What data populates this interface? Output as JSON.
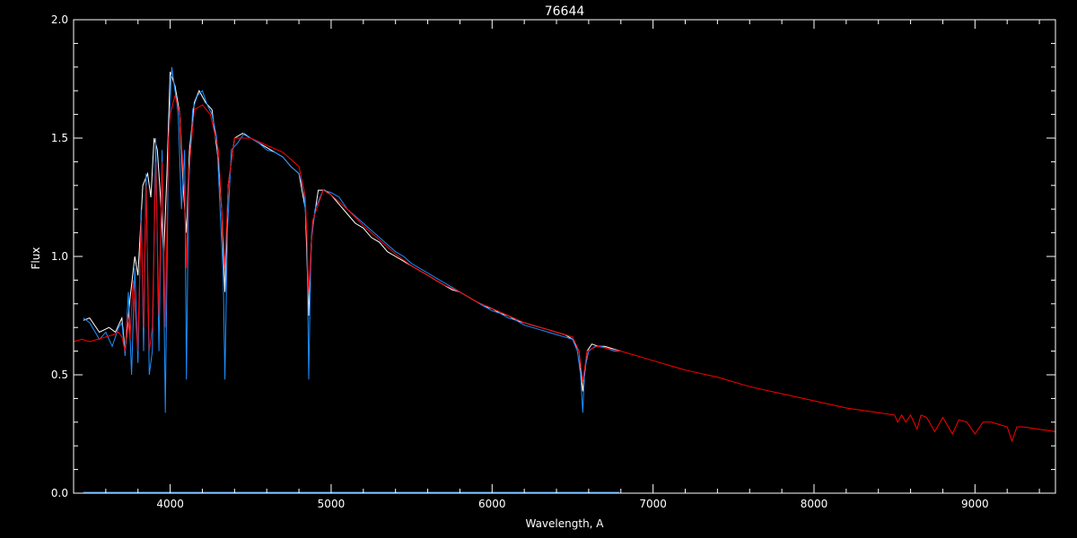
{
  "chart_data": {
    "type": "line",
    "title": "76644",
    "xlabel": "Wavelength, A",
    "ylabel": "Flux",
    "xlim": [
      3400,
      9500
    ],
    "ylim": [
      0.0,
      2.0
    ],
    "xticks": [
      4000,
      5000,
      6000,
      7000,
      8000,
      9000
    ],
    "xtick_labels": [
      "4000",
      "5000",
      "6000",
      "7000",
      "8000",
      "9000"
    ],
    "yticks": [
      0.0,
      0.5,
      1.0,
      1.5,
      2.0
    ],
    "ytick_labels": [
      "0.0",
      "0.5",
      "1.0",
      "1.5",
      "2.0"
    ],
    "grid": false,
    "background": "#000000",
    "axis_color": "#ffffff",
    "series": [
      {
        "color": "#ffffff",
        "x": [
          3460,
          3500,
          3560,
          3620,
          3660,
          3700,
          3720,
          3750,
          3780,
          3800,
          3830,
          3860,
          3880,
          3900,
          3920,
          3940,
          3960,
          3980,
          4000,
          4030,
          4060,
          4080,
          4101,
          4120,
          4150,
          4180,
          4220,
          4260,
          4300,
          4320,
          4340,
          4360,
          4400,
          4450,
          4500,
          4550,
          4600,
          4650,
          4700,
          4750,
          4800,
          4840,
          4861,
          4880,
          4920,
          4960,
          5000,
          5050,
          5100,
          5150,
          5200,
          5250,
          5300,
          5350,
          5400,
          5450,
          5500,
          5550,
          5600,
          5650,
          5700,
          5750,
          5800,
          5850,
          5900,
          5950,
          6000,
          6050,
          6100,
          6150,
          6200,
          6250,
          6300,
          6350,
          6400,
          6450,
          6500,
          6540,
          6563,
          6590,
          6620,
          6660,
          6700,
          6750,
          6800
        ],
        "y": [
          0.73,
          0.74,
          0.68,
          0.7,
          0.68,
          0.74,
          0.6,
          0.82,
          1.0,
          0.92,
          1.3,
          1.35,
          1.25,
          1.5,
          1.45,
          1.25,
          1.0,
          1.35,
          1.78,
          1.72,
          1.6,
          1.3,
          1.1,
          1.45,
          1.65,
          1.7,
          1.65,
          1.62,
          1.4,
          1.2,
          0.85,
          1.3,
          1.5,
          1.52,
          1.5,
          1.48,
          1.46,
          1.44,
          1.42,
          1.38,
          1.35,
          1.2,
          0.75,
          1.1,
          1.28,
          1.28,
          1.26,
          1.22,
          1.18,
          1.14,
          1.12,
          1.08,
          1.06,
          1.02,
          1.0,
          0.98,
          0.96,
          0.94,
          0.92,
          0.9,
          0.88,
          0.86,
          0.85,
          0.83,
          0.81,
          0.79,
          0.78,
          0.76,
          0.75,
          0.73,
          0.72,
          0.71,
          0.7,
          0.69,
          0.68,
          0.67,
          0.65,
          0.6,
          0.43,
          0.6,
          0.63,
          0.62,
          0.62,
          0.61,
          0.6
        ]
      },
      {
        "color": "#1e8fff",
        "x": [
          3460,
          3500,
          3560,
          3600,
          3640,
          3680,
          3700,
          3720,
          3740,
          3760,
          3780,
          3800,
          3820,
          3835,
          3850,
          3870,
          3889,
          3910,
          3930,
          3950,
          3970,
          3990,
          4010,
          4030,
          4050,
          4070,
          4090,
          4101,
          4115,
          4140,
          4170,
          4200,
          4230,
          4260,
          4290,
          4310,
          4330,
          4340,
          4355,
          4380,
          4420,
          4460,
          4500,
          4550,
          4600,
          4650,
          4700,
          4750,
          4800,
          4830,
          4850,
          4861,
          4875,
          4900,
          4950,
          5000,
          5050,
          5100,
          5150,
          5200,
          5250,
          5300,
          5350,
          5400,
          5450,
          5500,
          5550,
          5600,
          5650,
          5700,
          5750,
          5800,
          5850,
          5900,
          5950,
          6000,
          6050,
          6100,
          6150,
          6200,
          6250,
          6300,
          6350,
          6400,
          6450,
          6500,
          6530,
          6550,
          6563,
          6575,
          6600,
          6640,
          6680,
          6720,
          6760,
          6790
        ],
        "y": [
          0.74,
          0.72,
          0.65,
          0.68,
          0.62,
          0.7,
          0.72,
          0.58,
          0.85,
          0.5,
          0.95,
          0.55,
          1.2,
          0.6,
          1.35,
          0.5,
          0.6,
          1.5,
          0.6,
          1.45,
          0.34,
          1.5,
          1.8,
          1.7,
          1.6,
          1.2,
          1.45,
          0.48,
          1.3,
          1.62,
          1.68,
          1.7,
          1.64,
          1.6,
          1.5,
          1.2,
          0.9,
          0.48,
          1.1,
          1.45,
          1.48,
          1.52,
          1.5,
          1.48,
          1.45,
          1.44,
          1.42,
          1.38,
          1.35,
          1.28,
          1.1,
          0.48,
          1.05,
          1.2,
          1.28,
          1.27,
          1.25,
          1.2,
          1.17,
          1.14,
          1.11,
          1.08,
          1.05,
          1.02,
          1.0,
          0.97,
          0.95,
          0.93,
          0.91,
          0.89,
          0.87,
          0.85,
          0.83,
          0.81,
          0.79,
          0.77,
          0.76,
          0.74,
          0.73,
          0.71,
          0.7,
          0.69,
          0.68,
          0.67,
          0.66,
          0.65,
          0.6,
          0.5,
          0.34,
          0.52,
          0.6,
          0.62,
          0.62,
          0.61,
          0.6,
          0.6
        ]
      },
      {
        "color": "#ff0000",
        "x": [
          3400,
          3450,
          3500,
          3550,
          3600,
          3650,
          3680,
          3700,
          3720,
          3735,
          3750,
          3770,
          3798,
          3820,
          3835,
          3850,
          3870,
          3889,
          3910,
          3930,
          3950,
          3970,
          3990,
          4000,
          4030,
          4060,
          4090,
          4101,
          4115,
          4150,
          4200,
          4250,
          4300,
          4320,
          4340,
          4360,
          4400,
          4500,
          4600,
          4700,
          4800,
          4840,
          4861,
          4885,
          4950,
          5000,
          5100,
          5200,
          5300,
          5400,
          5500,
          5600,
          5700,
          5800,
          5900,
          6000,
          6100,
          6200,
          6300,
          6400,
          6500,
          6540,
          6563,
          6590,
          6650,
          6800,
          7000,
          7200,
          7400,
          7600,
          7800,
          8000,
          8200,
          8400,
          8500,
          8520,
          8545,
          8570,
          8600,
          8640,
          8665,
          8700,
          8750,
          8800,
          8860,
          8900,
          8950,
          9000,
          9050,
          9100,
          9150,
          9200,
          9230,
          9260,
          9300,
          9400,
          9500
        ],
        "y": [
          0.64,
          0.65,
          0.64,
          0.65,
          0.66,
          0.67,
          0.68,
          0.66,
          0.6,
          0.75,
          0.65,
          0.9,
          0.6,
          1.15,
          0.7,
          1.3,
          0.6,
          0.7,
          1.4,
          0.75,
          1.4,
          0.7,
          1.5,
          1.6,
          1.68,
          1.6,
          1.25,
          0.95,
          1.35,
          1.62,
          1.64,
          1.6,
          1.45,
          1.2,
          0.95,
          1.3,
          1.5,
          1.5,
          1.47,
          1.44,
          1.38,
          1.25,
          0.85,
          1.15,
          1.28,
          1.26,
          1.2,
          1.13,
          1.07,
          1.01,
          0.96,
          0.92,
          0.88,
          0.85,
          0.81,
          0.78,
          0.75,
          0.72,
          0.7,
          0.68,
          0.66,
          0.6,
          0.47,
          0.6,
          0.62,
          0.6,
          0.56,
          0.52,
          0.49,
          0.45,
          0.42,
          0.39,
          0.36,
          0.34,
          0.33,
          0.3,
          0.33,
          0.3,
          0.33,
          0.27,
          0.33,
          0.32,
          0.26,
          0.32,
          0.25,
          0.31,
          0.3,
          0.25,
          0.3,
          0.3,
          0.29,
          0.28,
          0.22,
          0.28,
          0.28,
          0.27,
          0.26
        ]
      }
    ]
  }
}
